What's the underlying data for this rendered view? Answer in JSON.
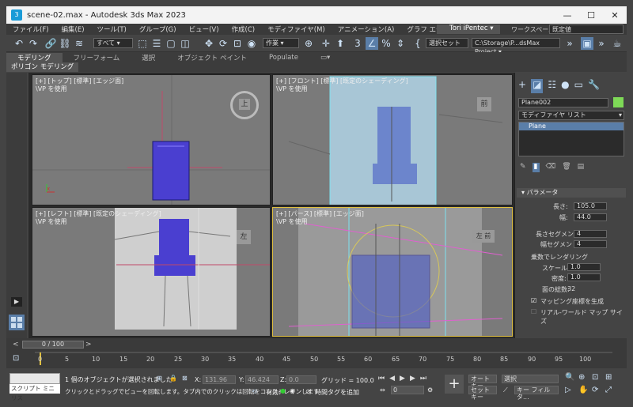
{
  "window": {
    "title": "scene-02.max - Autodesk 3ds Max 2023",
    "app_icon": "3ds-max-icon"
  },
  "menu": [
    "ファイル(F)",
    "編集(E)",
    "ツール(T)",
    "グループ(G)",
    "ビュー(V)",
    "作成(C)",
    "モディファイヤ(M)",
    "アニメーション(A)",
    "グラフ エディタ(D)",
    "»"
  ],
  "user": {
    "name": "Tori iPentec",
    "workspace_label": "ワークスペース:",
    "workspace_value": "既定値"
  },
  "toolbar": {
    "filter": "すべて",
    "selection_set": "作業",
    "create_selection_set": "選択セット",
    "project_path": "C:\\Storage\\P...dsMax Project"
  },
  "ribbon": {
    "tabs": [
      "モデリング",
      "フリーフォーム",
      "選択",
      "オブジェクト ペイント",
      "Populate"
    ],
    "active": "モデリング",
    "sub_tab": "ポリゴン モデリング"
  },
  "viewports": [
    {
      "label": "[+] [トップ] [標準] [エッジ面]",
      "sub": "\\VP を使用",
      "cube": "上"
    },
    {
      "label": "[+] [フロント] [標準] [既定のシェーディング]",
      "sub": "\\VP を使用",
      "cube": "前"
    },
    {
      "label": "[+] [レフト] [標準] [既定のシェーディング]",
      "sub": "\\VP を使用",
      "cube": "左"
    },
    {
      "label": "[+] [パース] [標準] [エッジ面]",
      "sub": "\\VP を使用",
      "cube": "左 前"
    }
  ],
  "command_panel": {
    "object_name": "Plane002",
    "object_color": "#7ed957",
    "modifier_list": "モディファイヤ リスト",
    "stack": [
      "Plane"
    ],
    "rollout": "パラメータ",
    "length_label": "長さ:",
    "length": "105.0",
    "width_label": "幅:",
    "width": "44.0",
    "length_segs_label": "長さセグメント:",
    "length_segs": "4",
    "width_segs_label": "幅セグメント:",
    "width_segs": "4",
    "render_mult": "乗数でレンダリング",
    "scale_label": "スケール:",
    "scale": "1.0",
    "density_label": "密度:",
    "density": "1.0",
    "faces_label": "面の総数:",
    "faces": "32",
    "gen_mapping": "マッピング座標を生成",
    "real_world": "リアル-ワールド マップ サイズ"
  },
  "timeline": {
    "slider": "0 / 100",
    "ticks": [
      "0",
      "5",
      "10",
      "15",
      "20",
      "25",
      "30",
      "35",
      "40",
      "45",
      "50",
      "55",
      "60",
      "65",
      "70",
      "75",
      "80",
      "85",
      "90",
      "95",
      "100"
    ]
  },
  "status": {
    "maxscript": "スクリプト ミニ リス",
    "selected": "1 個のオブジェクトが選択されました",
    "prompt": "クリックとドラッグでビューを回転します。タブ内でのクリックは回転をコンストレインします",
    "x_label": "X:",
    "x": "131.96",
    "y_label": "Y:",
    "y": "46.424",
    "z_label": "Z:",
    "z": "0.0",
    "grid": "グリッド = 100.0",
    "enabled": "有効:",
    "add_time_tag": "時間タグを追加",
    "frame": "0",
    "auto_key": "オート キー",
    "selected_dd": "選択",
    "set_key": "セット キー",
    "key_filters": "キー フィルタ..."
  }
}
